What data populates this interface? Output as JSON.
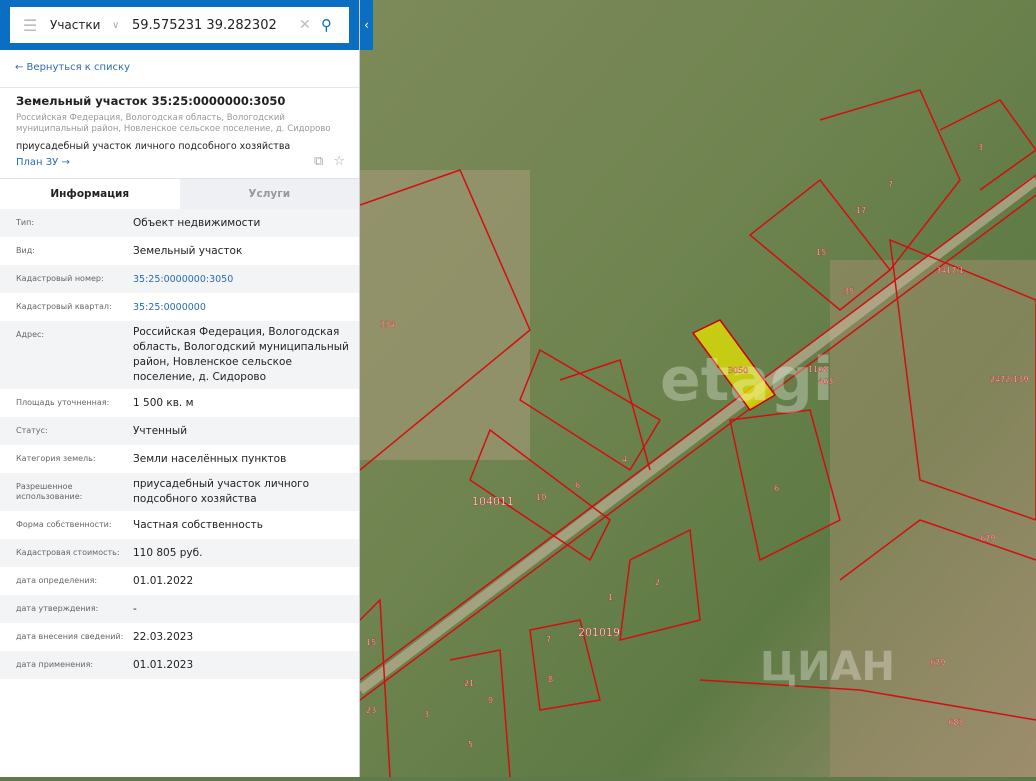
{
  "search": {
    "category": "Участки",
    "query": "59.575231 39.282302"
  },
  "back_link": "← Вернуться к списку",
  "object": {
    "title": "Земельный участок 35:25:0000000:3050",
    "address": "Российская Федерация, Вологодская область, Вологодский муниципальный район, Новленское сельское поселение, д. Сидорово",
    "purpose": "приусадебный участок личного подсобного хозяйства",
    "plan_link": "План ЗУ →"
  },
  "tabs": [
    {
      "label": "Информация"
    },
    {
      "label": "Услуги"
    }
  ],
  "info": [
    {
      "label": "Тип:",
      "value": "Объект недвижимости"
    },
    {
      "label": "Вид:",
      "value": "Земельный участок"
    },
    {
      "label": "Кадастровый номер:",
      "value": "35:25:0000000:3050",
      "link": true
    },
    {
      "label": "Кадастровый квартал:",
      "value": "35:25:0000000",
      "link": true
    },
    {
      "label": "Адрес:",
      "value": "Российская Федерация, Вологодская область, Вологодский муниципальный район, Новленское сельское поселение, д. Сидорово"
    },
    {
      "label": "Площадь уточненная:",
      "value": "1 500 кв. м"
    },
    {
      "label": "Статус:",
      "value": "Учтенный"
    },
    {
      "label": "Категория земель:",
      "value": "Земли населённых пунктов"
    },
    {
      "label": "Разрешенное использование:",
      "value": "приусадебный участок личного подсобного хозяйства"
    },
    {
      "label": "Форма собственности:",
      "value": "Частная собственность"
    },
    {
      "label": "Кадастровая стоимость:",
      "value": "110 805 руб."
    },
    {
      "label": "дата определения:",
      "value": "01.01.2022"
    },
    {
      "label": "дата утверждения:",
      "value": "-"
    },
    {
      "label": "дата внесения сведений:",
      "value": "22.03.2023"
    },
    {
      "label": "дата применения:",
      "value": "01.01.2023"
    }
  ],
  "map": {
    "watermarks": [
      "etagi",
      "ЦИАН"
    ],
    "parcel_labels": [
      "334",
      "104011",
      "10",
      "6",
      "4",
      "201019",
      "1",
      "2",
      "7",
      "8",
      "21",
      "9",
      "3",
      "5",
      "23",
      "15",
      "17",
      "7",
      "3",
      "15",
      "35",
      "3417/1",
      "1168",
      "463",
      "2472/139",
      "679",
      "679",
      "683",
      "3050",
      "6"
    ],
    "highlight_color": "#e6e600",
    "boundary_color": "#d01010"
  }
}
